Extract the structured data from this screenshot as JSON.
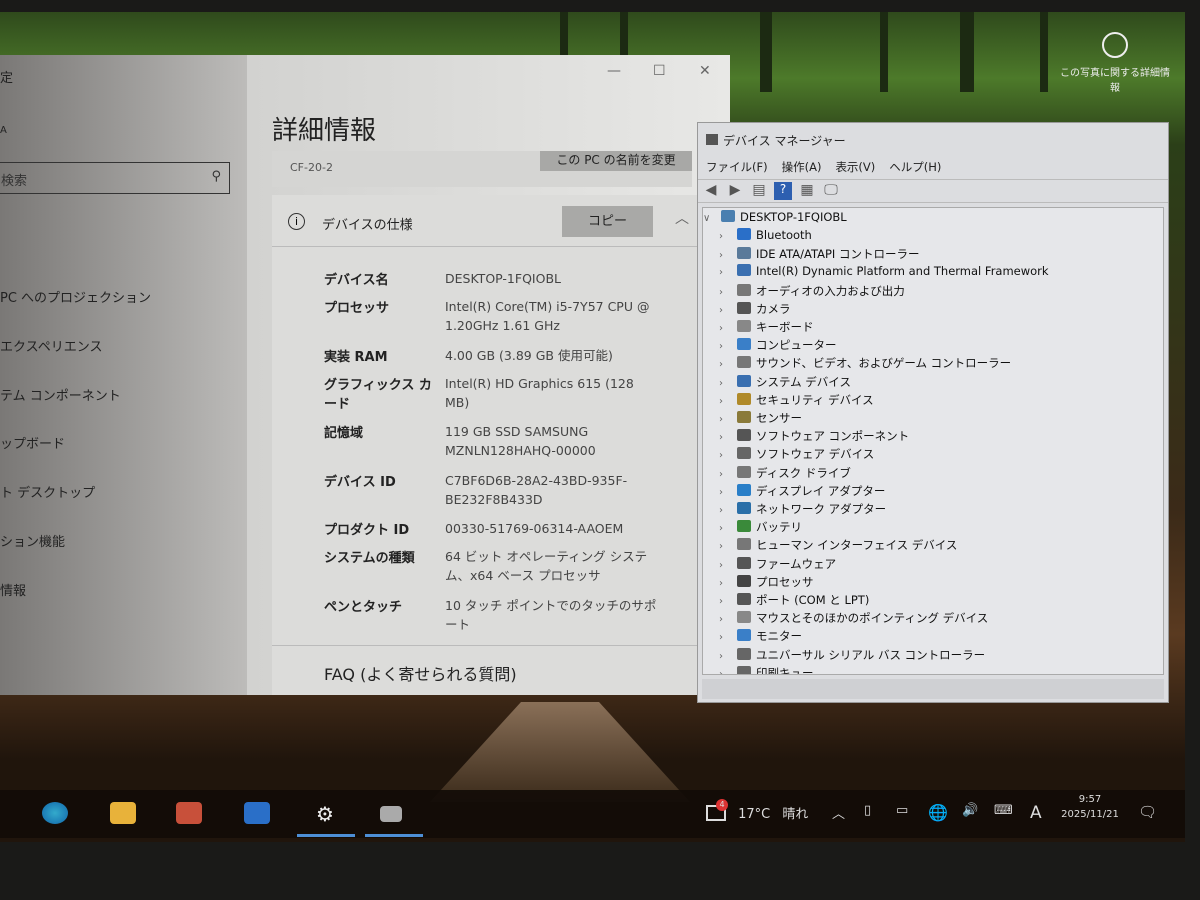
{
  "desktop": {
    "spotlight_label": "この写真に関する詳細情報"
  },
  "settings": {
    "title_fragment": "定",
    "user_fragment": "A",
    "search_placeholder": "検索",
    "sidebar": [
      "PC へのプロジェクション",
      "エクスペリエンス",
      "テム コンポーネント",
      "ップボード",
      "ト デスクトップ",
      "ション機能",
      "情報"
    ],
    "page_title": "詳細情報",
    "pc_model": "CF-20-2",
    "rename_button": "この PC の名前を変更",
    "spec_header": "デバイスの仕様",
    "copy_button": "コピー",
    "specs": [
      {
        "k": "デバイス名",
        "v": "DESKTOP-1FQIOBL"
      },
      {
        "k": "プロセッサ",
        "v": "Intel(R) Core(TM) i5-7Y57 CPU @ 1.20GHz   1.61 GHz"
      },
      {
        "k": "実装 RAM",
        "v": "4.00 GB (3.89 GB 使用可能)"
      },
      {
        "k": "グラフィックス カード",
        "v": "Intel(R) HD Graphics 615 (128 MB)"
      },
      {
        "k": "記憶域",
        "v": "119 GB SSD SAMSUNG MZNLN128HAHQ-00000"
      },
      {
        "k": "デバイス ID",
        "v": "C7BF6D6B-28A2-43BD-935F-BE232F8B433D"
      },
      {
        "k": "プロダクト ID",
        "v": "00330-51769-06314-AAOEM"
      },
      {
        "k": "システムの種類",
        "v": "64 ビット オペレーティング システム、x64 ベース プロセッサ"
      },
      {
        "k": "ペンとタッチ",
        "v": "10 タッチ ポイントでのタッチのサポート"
      }
    ],
    "faq": "FAQ (よく寄せられる質問)"
  },
  "devmgr": {
    "title": "デバイス マネージャー",
    "menu": [
      "ファイル(F)",
      "操作(A)",
      "表示(V)",
      "ヘルプ(H)"
    ],
    "root": "DESKTOP-1FQIOBL",
    "items": [
      "Bluetooth",
      "IDE ATA/ATAPI コントローラー",
      "Intel(R) Dynamic Platform and Thermal Framework",
      "オーディオの入力および出力",
      "カメラ",
      "キーボード",
      "コンピューター",
      "サウンド、ビデオ、およびゲーム コントローラー",
      "システム デバイス",
      "セキュリティ デバイス",
      "センサー",
      "ソフトウェア コンポーネント",
      "ソフトウェア デバイス",
      "ディスク ドライブ",
      "ディスプレイ アダプター",
      "ネットワーク アダプター",
      "バッテリ",
      "ヒューマン インターフェイス デバイス",
      "ファームウェア",
      "プロセッサ",
      "ポート (COM と LPT)",
      "マウスとそのほかのポインティング デバイス",
      "モニター",
      "ユニバーサル シリアル バス コントローラー",
      "印刷キュー"
    ]
  },
  "taskbar": {
    "weather_badge": "4",
    "temp": "17°C",
    "weather": "晴れ",
    "ime": "A",
    "time": "9:57",
    "date": "2025/11/21"
  }
}
